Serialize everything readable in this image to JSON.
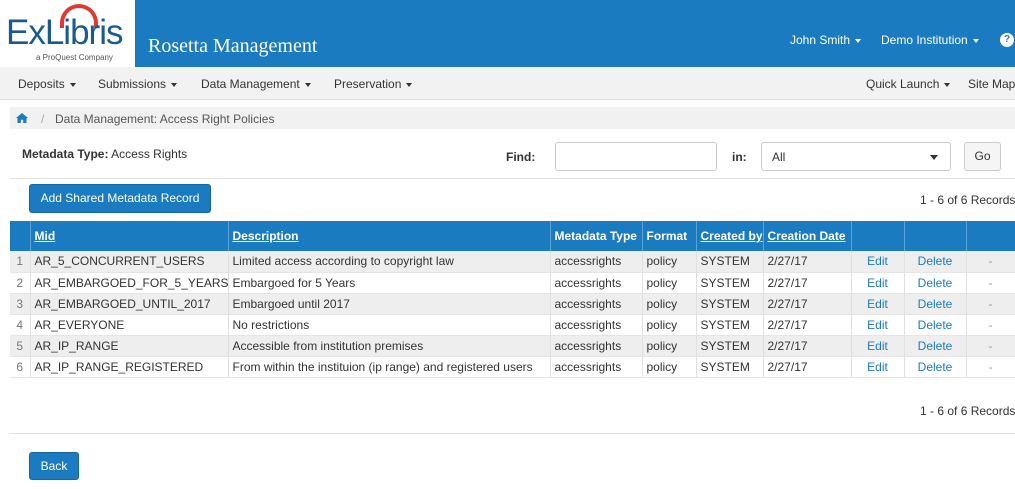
{
  "brand": {
    "logo_text": "ExLibris",
    "logo_subtext": "a ProQuest Company",
    "app_title": "Rosetta Management"
  },
  "header": {
    "user_name": "John Smith",
    "institution": "Demo Institution",
    "help_glyph": "?"
  },
  "nav": {
    "left": [
      {
        "label": "Deposits"
      },
      {
        "label": "Submissions"
      },
      {
        "label": "Data Management"
      },
      {
        "label": "Preservation"
      }
    ],
    "quick_launch": "Quick Launch",
    "site_map": "Site Map"
  },
  "breadcrumb": {
    "separator": "/",
    "text": "Data Management: Access Right Policies"
  },
  "filter": {
    "metadata_type_label": "Metadata Type:",
    "metadata_type_value": "Access Rights",
    "find_label": "Find:",
    "find_value": "",
    "in_label": "in:",
    "in_selected": "All",
    "go_label": "Go"
  },
  "actions": {
    "add_label": "Add Shared Metadata Record",
    "back_label": "Back"
  },
  "records_summary": "1 - 6 of 6 Records",
  "table": {
    "columns": [
      "",
      "Mid",
      "Description",
      "Metadata Type",
      "Format",
      "Created by",
      "Creation Date",
      "",
      "",
      ""
    ],
    "rows": [
      {
        "num": "1",
        "mid": "AR_5_CONCURRENT_USERS",
        "description": "Limited access according to copyright law",
        "type": "accessrights",
        "format": "policy",
        "created_by": "SYSTEM",
        "date": "2/27/17",
        "edit": "Edit",
        "delete": "Delete",
        "extra": "-"
      },
      {
        "num": "2",
        "mid": "AR_EMBARGOED_FOR_5_YEARS",
        "description": "Embargoed for 5 Years",
        "type": "accessrights",
        "format": "policy",
        "created_by": "SYSTEM",
        "date": "2/27/17",
        "edit": "Edit",
        "delete": "Delete",
        "extra": "-"
      },
      {
        "num": "3",
        "mid": "AR_EMBARGOED_UNTIL_2017",
        "description": "Embargoed until 2017",
        "type": "accessrights",
        "format": "policy",
        "created_by": "SYSTEM",
        "date": "2/27/17",
        "edit": "Edit",
        "delete": "Delete",
        "extra": "-"
      },
      {
        "num": "4",
        "mid": "AR_EVERYONE",
        "description": "No restrictions",
        "type": "accessrights",
        "format": "policy",
        "created_by": "SYSTEM",
        "date": "2/27/17",
        "edit": "Edit",
        "delete": "Delete",
        "extra": "-"
      },
      {
        "num": "5",
        "mid": "AR_IP_RANGE",
        "description": "Accessible from institution premises",
        "type": "accessrights",
        "format": "policy",
        "created_by": "SYSTEM",
        "date": "2/27/17",
        "edit": "Edit",
        "delete": "Delete",
        "extra": "-"
      },
      {
        "num": "6",
        "mid": "AR_IP_RANGE_REGISTERED",
        "description": "From within the instituion (ip range) and registered users",
        "type": "accessrights",
        "format": "policy",
        "created_by": "SYSTEM",
        "date": "2/27/17",
        "edit": "Edit",
        "delete": "Delete",
        "extra": "-"
      }
    ]
  },
  "colors": {
    "primary": "#1a7bc0",
    "logo_arc": "#e03a2f",
    "nav_bg": "#f2f2f2",
    "row_alt": "#eeeeee"
  }
}
